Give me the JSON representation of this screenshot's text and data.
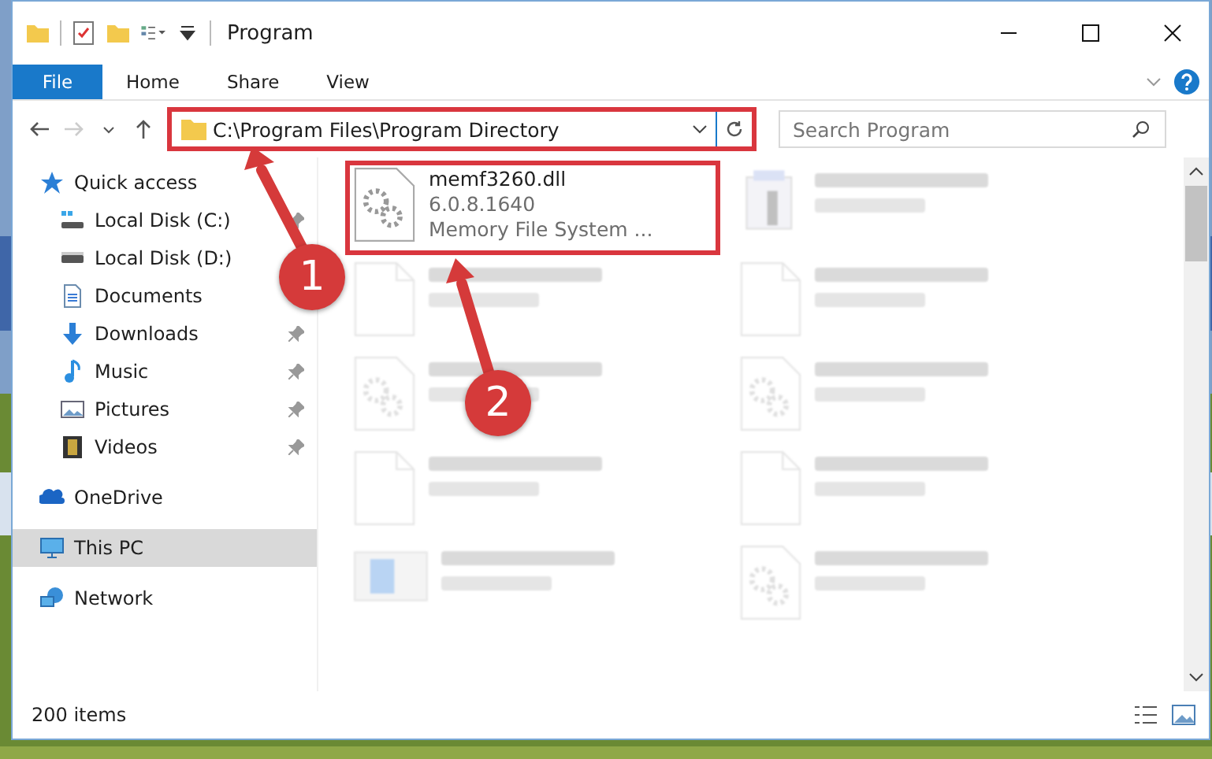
{
  "window": {
    "title": "Program"
  },
  "ribbon": {
    "tabs": [
      {
        "label": "File",
        "kind": "file"
      },
      {
        "label": "Home",
        "kind": "tab"
      },
      {
        "label": "Share",
        "kind": "tab"
      },
      {
        "label": "View",
        "kind": "tab"
      }
    ]
  },
  "address_bar": {
    "path": "C:\\Program Files\\Program Directory",
    "highlighted": true
  },
  "search": {
    "placeholder": "Search Program"
  },
  "sidebar": {
    "items": [
      {
        "label": "Quick access",
        "kind": "star",
        "selected": false,
        "children": [
          {
            "label": "Local Disk (C:)",
            "kind": "drive-c",
            "pinned": true
          },
          {
            "label": "Local Disk (D:)",
            "kind": "drive",
            "pinned": false
          },
          {
            "label": "Documents",
            "kind": "documents",
            "pinned": false
          },
          {
            "label": "Downloads",
            "kind": "downloads",
            "pinned": true
          },
          {
            "label": "Music",
            "kind": "music",
            "pinned": true
          },
          {
            "label": "Pictures",
            "kind": "pictures",
            "pinned": true
          },
          {
            "label": "Videos",
            "kind": "videos",
            "pinned": true
          }
        ]
      },
      {
        "label": "OneDrive",
        "kind": "cloud",
        "selected": false
      },
      {
        "label": "This PC",
        "kind": "pc",
        "selected": true
      },
      {
        "label": "Network",
        "kind": "network",
        "selected": false
      }
    ]
  },
  "files": [
    {
      "name": "memf3260.dll",
      "details": [
        "6.0.8.1640",
        "Memory File System ..."
      ],
      "kind": "dll",
      "highlighted": true,
      "faded": false
    },
    {
      "kind": "exe",
      "highlighted": false,
      "faded": true
    },
    {
      "kind": "file",
      "highlighted": false,
      "faded": true
    },
    {
      "kind": "file",
      "highlighted": false,
      "faded": true
    },
    {
      "kind": "dll",
      "highlighted": false,
      "faded": true
    },
    {
      "kind": "dll",
      "highlighted": false,
      "faded": true
    },
    {
      "kind": "file",
      "highlighted": false,
      "faded": true
    },
    {
      "kind": "file",
      "highlighted": false,
      "faded": true
    },
    {
      "kind": "installer",
      "highlighted": false,
      "faded": true
    },
    {
      "kind": "dll",
      "highlighted": false,
      "faded": true
    }
  ],
  "status_bar": {
    "item_count": "200 items"
  },
  "annotations": [
    {
      "number": "1"
    },
    {
      "number": "2"
    }
  ]
}
